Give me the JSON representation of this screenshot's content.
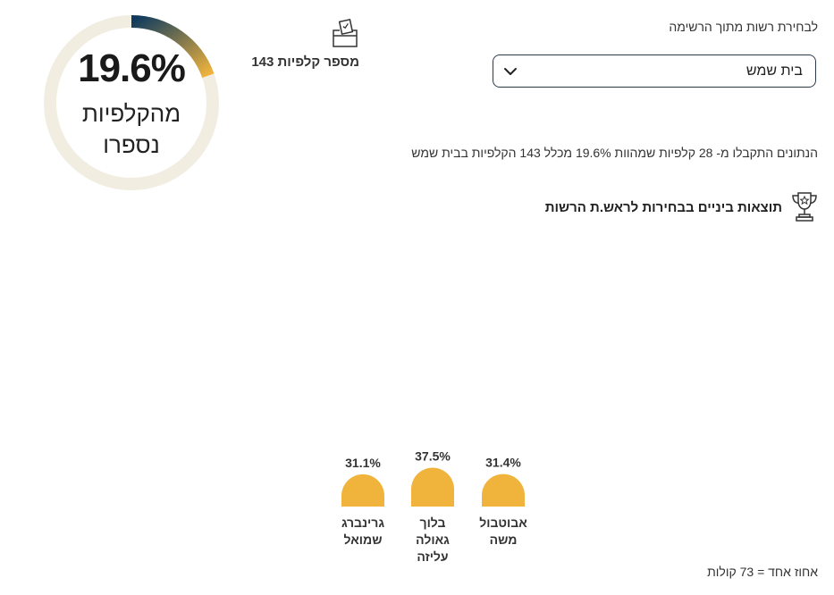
{
  "selector": {
    "label": "לבחירת רשות מתוך הרשימה",
    "value": "בית שמש",
    "chevron_icon": "chevron-down-icon"
  },
  "ballots": {
    "icon": "ballot-box-icon",
    "text": "מספר קלפיות 143"
  },
  "counted": {
    "percent_text": "19.6%",
    "percent_value": 19.6,
    "line1": "מהקלפיות",
    "line2": "נספרו",
    "track_color": "#f1ede1",
    "gradient_start": "#0f3a5f",
    "gradient_end": "#f0b43c"
  },
  "info_text": "הנתונים התקבלו מ- 28 קלפיות שמהוות 19.6% מכלל 143 הקלפיות בבית שמש",
  "results": {
    "icon": "trophy-icon",
    "title": "תוצאות ביניים בבחירות לראש.ת הרשות"
  },
  "chart_data": {
    "type": "bar",
    "categories": [
      "אבוטבול משה",
      "בלוך גאולה עליזה",
      "גרינברג שמואל"
    ],
    "values": [
      31.4,
      37.5,
      31.1
    ],
    "value_labels": [
      "31.4%",
      "37.5%",
      "31.1%"
    ],
    "name_lines": [
      [
        "אבוטבול",
        "משה"
      ],
      [
        "בלוך גאולה",
        "עליזה"
      ],
      [
        "גרינברג",
        "שמואל"
      ]
    ],
    "bar_color": "#f0b43c",
    "order": "right-to-left"
  },
  "footnote": "אחוז אחד = 73 קולות"
}
